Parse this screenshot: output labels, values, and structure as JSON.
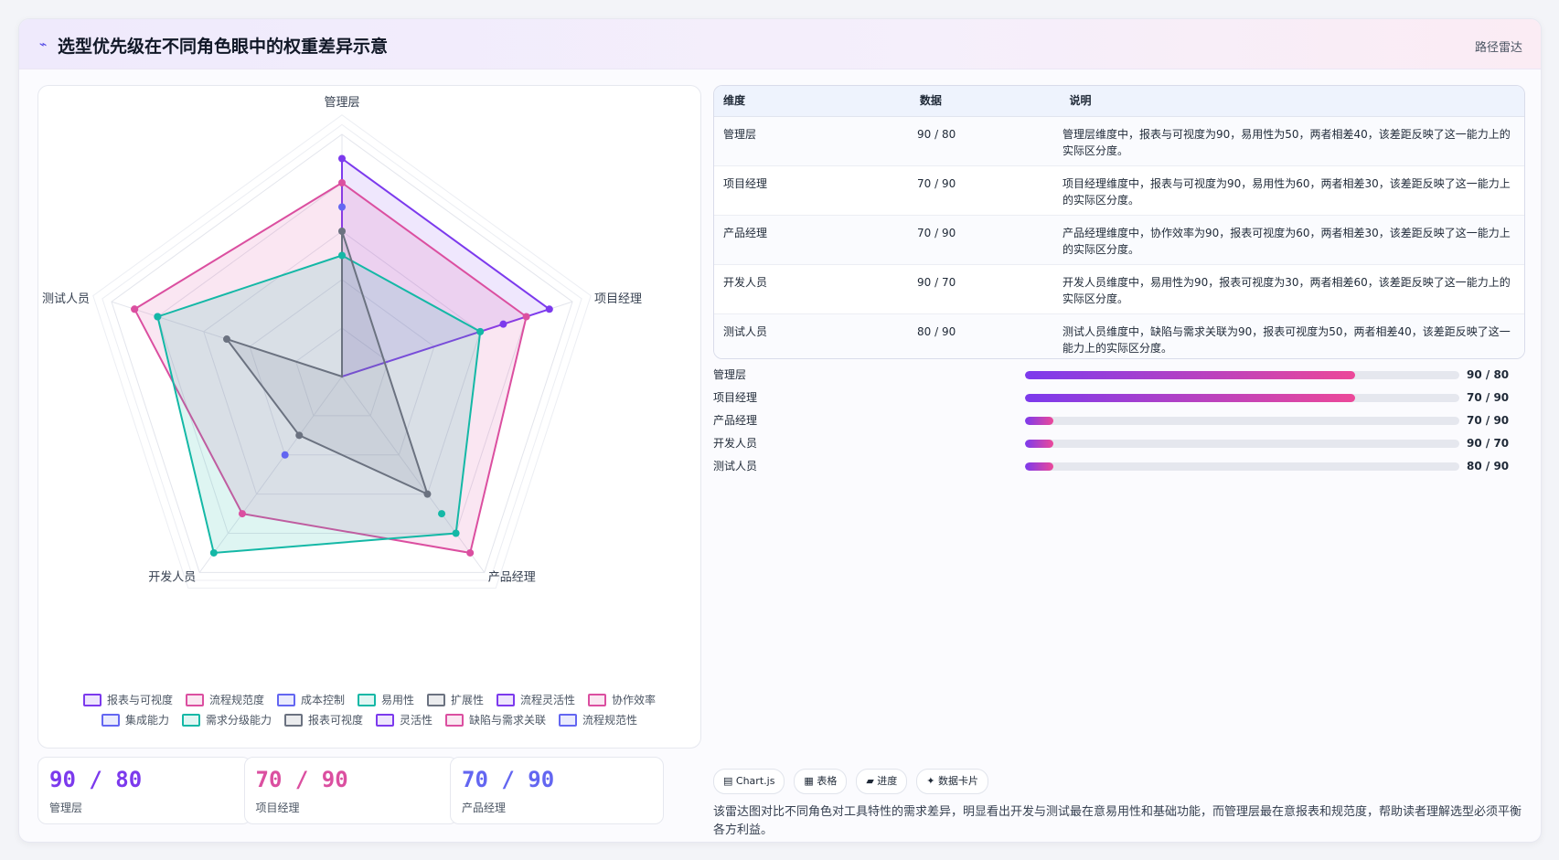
{
  "header": {
    "title": "选型优先级在不同角色眼中的权重差异示意",
    "tag": "路径雷达",
    "logo_icon": "line-chart-icon"
  },
  "chart_data": {
    "type": "radar",
    "axes": [
      "管理层",
      "项目经理",
      "产品经理",
      "开发人员",
      "测试人员"
    ],
    "range": [
      0,
      100
    ],
    "series": [
      {
        "name": "报表与可视度",
        "values": [
          90,
          90,
          null,
          null,
          null
        ],
        "color": "#7c3aed",
        "fill": true
      },
      {
        "name": "流程规范度",
        "values": [
          80,
          80,
          90,
          70,
          90
        ],
        "color": "#db4fa0",
        "fill": true
      },
      {
        "name": "成本控制",
        "values": [
          70,
          null,
          null,
          null,
          80
        ],
        "color": "#6366f1",
        "fill": false
      },
      {
        "name": "易用性",
        "values": [
          50,
          60,
          80,
          90,
          80
        ],
        "color": "#14b8a6",
        "fill": true
      },
      {
        "name": "扩展性",
        "values": [
          60,
          null,
          60,
          30,
          50
        ],
        "color": "#6b7280",
        "fill": true
      },
      {
        "name": "流程灵活性",
        "values": [
          null,
          70,
          null,
          null,
          null
        ],
        "color": "#7c3aed",
        "fill": false
      },
      {
        "name": "协作效率",
        "values": [
          null,
          null,
          null,
          null,
          90
        ],
        "color": "#db4fa0",
        "fill": false
      },
      {
        "name": "集成能力",
        "values": [
          null,
          null,
          null,
          40,
          null
        ],
        "color": "#6366f1",
        "fill": false
      },
      {
        "name": "需求分级能力",
        "values": [
          null,
          null,
          70,
          null,
          null
        ],
        "color": "#14b8a6",
        "fill": false
      },
      {
        "name": "报表可视度",
        "values": [],
        "color": "#6b7280",
        "fill": false
      },
      {
        "name": "灵活性",
        "values": [],
        "color": "#7c3aed",
        "fill": false
      },
      {
        "name": "缺陷与需求关联",
        "values": [],
        "color": "#db4fa0",
        "fill": false
      },
      {
        "name": "流程规范性",
        "values": [],
        "color": "#6366f1",
        "fill": false
      }
    ],
    "grid": true,
    "legend_position": "bottom"
  },
  "table": {
    "headers": [
      "维度",
      "数据",
      "说明"
    ],
    "rows": [
      {
        "dim": "管理层",
        "data": "90 / 80",
        "desc": "管理层维度中，报表与可视度为90，易用性为50，两者相差40，该差距反映了这一能力上的实际区分度。"
      },
      {
        "dim": "项目经理",
        "data": "70 / 90",
        "desc": "项目经理维度中，报表与可视度为90，易用性为60，两者相差30，该差距反映了这一能力上的实际区分度。"
      },
      {
        "dim": "产品经理",
        "data": "70 / 90",
        "desc": "产品经理维度中，协作效率为90，报表可视度为60，两者相差30，该差距反映了这一能力上的实际区分度。"
      },
      {
        "dim": "开发人员",
        "data": "90 / 70",
        "desc": "开发人员维度中，易用性为90，报表可视度为30，两者相差60，该差距反映了这一能力上的实际区分度。"
      },
      {
        "dim": "测试人员",
        "data": "80 / 90",
        "desc": "测试人员维度中，缺陷与需求关联为90，报表可视度为50，两者相差40，该差距反映了这一能力上的实际区分度。"
      }
    ]
  },
  "bars": [
    {
      "label": "管理层",
      "value": "90 / 80",
      "progress": 0.76
    },
    {
      "label": "项目经理",
      "value": "70 / 90",
      "progress": 0.76
    },
    {
      "label": "产品经理",
      "value": "70 / 90",
      "progress": 0.065
    },
    {
      "label": "开发人员",
      "value": "90 / 70",
      "progress": 0.065
    },
    {
      "label": "测试人员",
      "value": "80 / 90",
      "progress": 0.065
    }
  ],
  "stats": [
    {
      "value": "90 / 80",
      "label": "管理层",
      "color": "#7c3aed"
    },
    {
      "value": "70 / 90",
      "label": "项目经理",
      "color": "#db4fa0"
    },
    {
      "value": "70 / 90",
      "label": "产品经理",
      "color": "#6366f1"
    }
  ],
  "chips": [
    {
      "icon": "chart-icon",
      "glyph": "▤",
      "label": "Chart.js"
    },
    {
      "icon": "table-icon",
      "glyph": "▦",
      "label": "表格"
    },
    {
      "icon": "progress-icon",
      "glyph": "▰",
      "label": "进度"
    },
    {
      "icon": "sparkle-icon",
      "glyph": "✦",
      "label": "数据卡片"
    }
  ],
  "description": "该雷达图对比不同角色对工具特性的需求差异，明显看出开发与测试最在意易用性和基础功能，而管理层最在意报表和规范度，帮助读者理解选型必须平衡各方利益。"
}
